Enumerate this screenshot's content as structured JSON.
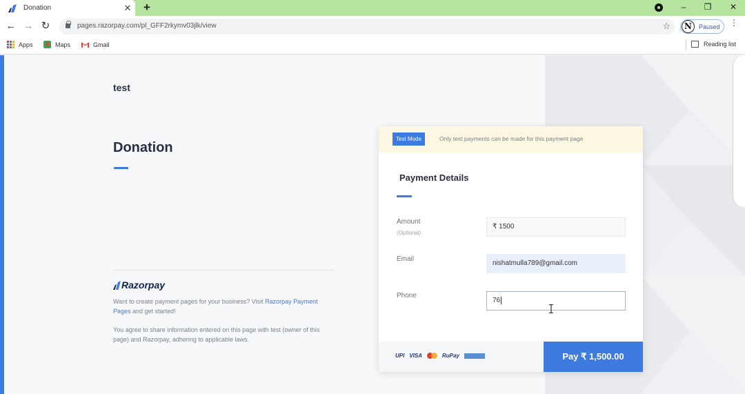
{
  "browser": {
    "tab_title": "Donation",
    "tab_close": "✕",
    "new_tab": "+",
    "window_minimize": "–",
    "window_restore": "❐",
    "window_close": "✕",
    "nav_back": "←",
    "nav_forward": "→",
    "nav_reload": "↻",
    "url": "pages.razorpay.com/pl_GFF2rkymv03jlk/view",
    "star": "☆",
    "profile_initial": "N",
    "profile_status": "Paused",
    "menu": "⋮",
    "bookmarks": [
      {
        "label": "Apps"
      },
      {
        "label": "Maps"
      },
      {
        "label": "Gmail"
      }
    ],
    "reading_list": "Reading list"
  },
  "page": {
    "merchant_name": "test",
    "heading": "Donation",
    "footer": {
      "brand": "Razorpay",
      "text1_prefix": "Want to create payment pages for your business? Visit ",
      "text1_link": "Razorpay Payment Pages",
      "text1_suffix": " and get started!",
      "text2": "You agree to share information entered on this page with test (owner of this page) and Razorpay, adhering to applicable laws."
    }
  },
  "card": {
    "test_badge": "Test Mode",
    "test_note": "Only test payments can be made for this payment page",
    "title": "Payment Details",
    "fields": {
      "amount": {
        "label": "Amount",
        "sub": "(Optional)",
        "value": "₹ 1500"
      },
      "email": {
        "label": "Email",
        "value": "nishatmulla789@gmail.com"
      },
      "phone": {
        "label": "Phone",
        "value": "76"
      }
    },
    "payment_methods": [
      "UPI",
      "VISA",
      "RuPay"
    ],
    "pay_button": "Pay ₹ 1,500.00"
  },
  "colors": {
    "accent": "#3d7be0",
    "tabbar": "#b6e3a0",
    "test_banner": "#fbf7e3"
  }
}
